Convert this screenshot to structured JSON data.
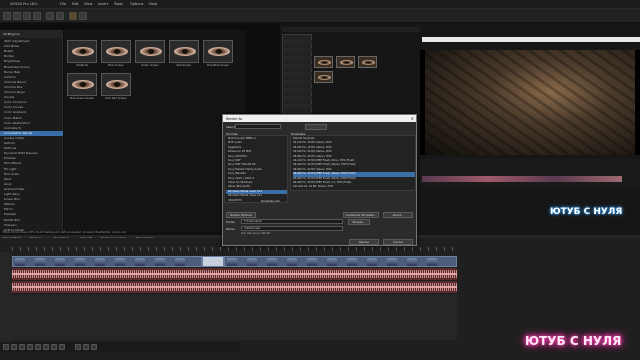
{
  "window": {
    "title": "VEGAS Pro 18.0",
    "menu": [
      "File",
      "Edit",
      "View",
      "Insert",
      "Tools",
      "Options",
      "Help"
    ]
  },
  "plugin_panel": {
    "header": "All Plug-Ins",
    "search_placeholder": "Search",
    "items": [
      "360° Adjustment",
      "Add Noise",
      "Bokeh",
      "Border",
      "Brightness",
      "Broadcast Colors",
      "Bump Map",
      "Cartoon",
      "Channel Blend",
      "Chroma Blur",
      "Chroma Keyer",
      "Clouds",
      "Color Corrector",
      "Color Curves",
      "Color Gradient",
      "Color Match",
      "Color Restoration",
      "Colorista IV",
      "Convolution Kernel",
      "Cookie Cutter",
      "Deform",
      "Defocus",
      "Dynamic RAM Preview",
      "Emboss",
      "Film Effects",
      "Fill Light",
      "Film Grain",
      "Glint",
      "Glow",
      "Gradient Map",
      "Light Rays",
      "Linear Blur",
      "Median",
      "Mirror",
      "Pixelate",
      "Radial Blur",
      "Sharpen",
      "Soft Contrast",
      "Starburst"
    ],
    "selected_index": 18
  },
  "presets": {
    "items": [
      {
        "label": "(Default)"
      },
      {
        "label": "Blue Screen"
      },
      {
        "label": "Green Screen"
      },
      {
        "label": "Red Screen"
      },
      {
        "label": "Pure Blue Screen"
      },
      {
        "label": "Pure Green Screen"
      },
      {
        "label": "Pure Red Screen"
      }
    ]
  },
  "render_dialog": {
    "title": "Render As",
    "close_glyph": "✕",
    "search_label": "Search",
    "formats_header": "Formats",
    "formats": [
      "MainConcept MPEG-2",
      "MP3 Audio",
      "OggVorbis",
      "Panasonic P2 MXF",
      "Sony AVC/MVC",
      "Sony MXF",
      "Sony MXF HDCAM SR",
      "Sony Perfect Clarity Audio",
      "Sony Wave64",
      "Sony XAVC / XAVC S",
      "Video for Windows",
      "Wave (Microsoft)",
      "Windows Media Audio V11",
      "Windows Media Video V11",
      "XDCAM EX"
    ],
    "formats_selected": 12,
    "templates_header": "Templates",
    "templates": [
      "Default Template",
      "44,100 Hz, 16 Bit, Stereo, PCM",
      "48,000 Hz, 16 Bit, Stereo, PCM",
      "44,100 Hz, 24 Bit, Stereo, PCM",
      "48,000 Hz, 24 Bit, Stereo, PCM",
      "44,100 Hz, 32 Bit (IEEE Float), Mono, PCM (Float)",
      "48,000 Hz, 32 Bit (IEEE Float), Stereo, PCM (Float)",
      "96,000 Hz, 24 Bit, Stereo, PCM",
      "48,000 Hz, 32 Bit (IEEE Float), Stereo, PCM (Float)",
      "96,000 Hz, 32 Bit (IEEE Float), Stereo, PCM (Float)",
      "96,000 Hz, 32 Bit (IEEE Float), 5.1, PCM (Float)",
      "192,000 Hz, 24 Bit, Stereo, PCM"
    ],
    "templates_selected": 8,
    "template_info_label": "Template info",
    "render_options_label": "Render Options",
    "customize_label": "Customize Template...",
    "about_label": "About...",
    "folder_label": "Folder:",
    "folder_value": "C:\\Users\\anon",
    "browse_label": "Browse...",
    "name_label": "Name:",
    "name_value": "Untitled.wav",
    "free_space": "Free disk space: 186 GB",
    "render_button": "Render",
    "cancel_button": "Cancel"
  },
  "bottom_tabs": [
    "Project Media",
    "Explorer",
    "Transitions",
    "Video FX",
    "Media Generators",
    "Project Notes"
  ],
  "status_text": "VEGAS Chroma Keyer (OFX, 32-bit floating point, GPU Accelerated, Grouping VEGAS\\Utility, Version 1.0)",
  "overlay": {
    "small": "ЮТУБ С НУЛЯ",
    "big": "ЮТУБ С НУЛЯ"
  },
  "colors": {
    "accent": "#3a6ea8",
    "glow": "#ff3fb4"
  }
}
